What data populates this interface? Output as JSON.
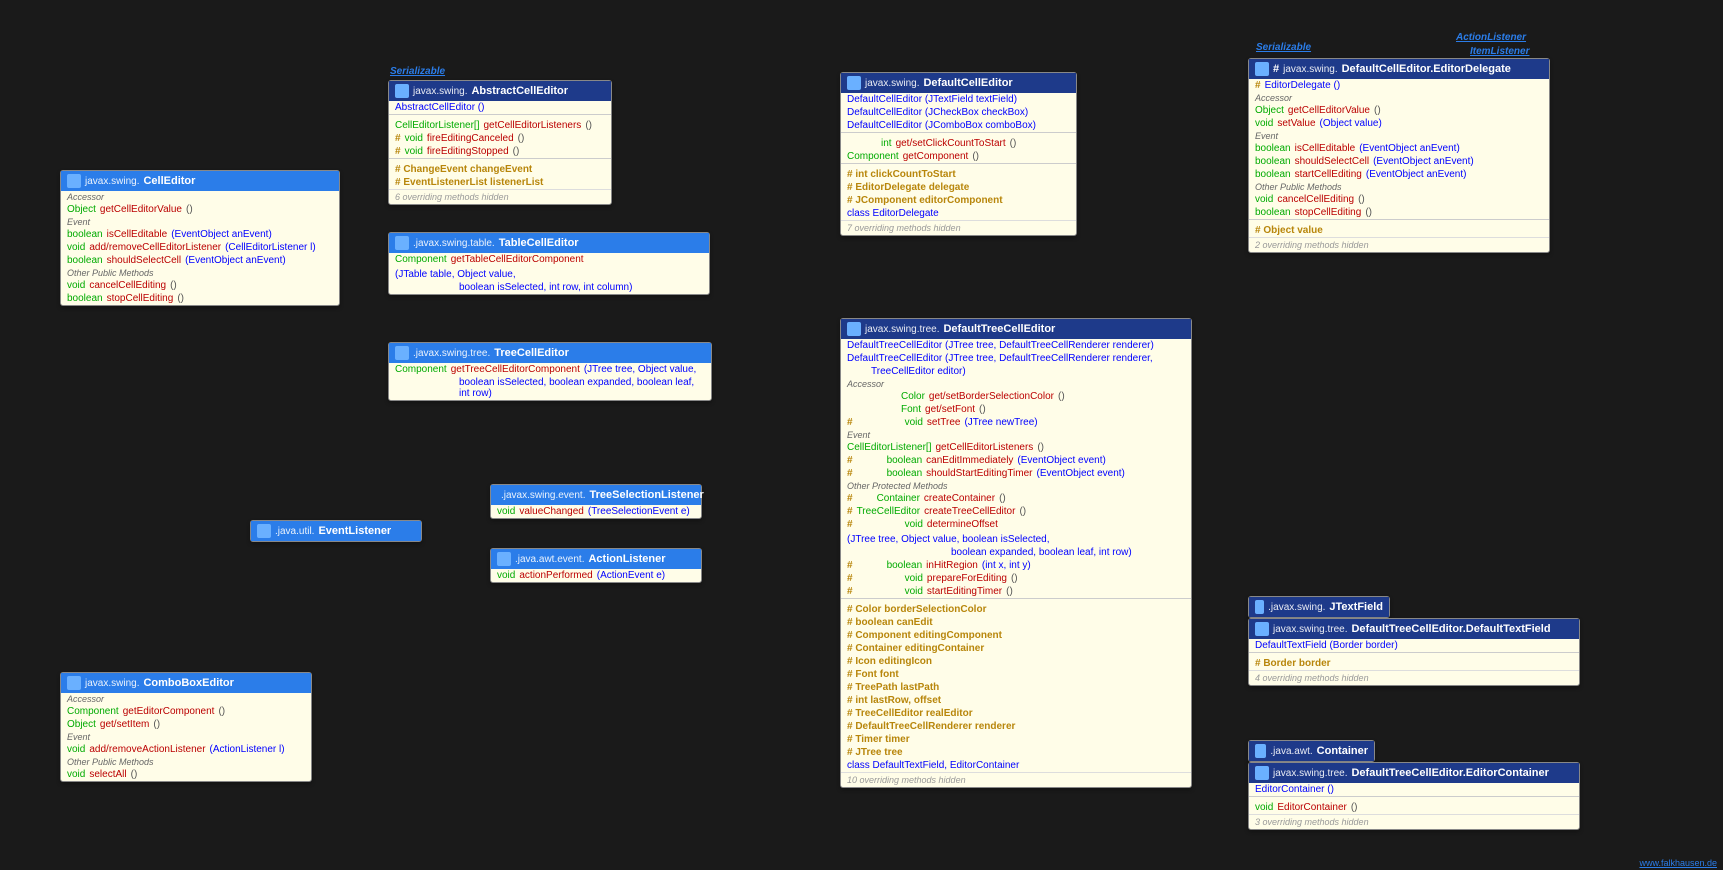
{
  "impl_serial": "Serializable",
  "impl_action": "ActionListener",
  "impl_item": "ItemListener",
  "footer": "www.falkhausen.de",
  "CellEditor": {
    "pkg": "javax.swing.",
    "title": "CellEditor",
    "lbl_accessor": "Accessor",
    "r1_t": "Object",
    "r1_n": "getCellEditorValue",
    "r1_p": "()",
    "lbl_event": "Event",
    "r2_t": "boolean",
    "r2_n": "isCellEditable",
    "r2_p": "(EventObject anEvent)",
    "r3_t": "void",
    "r3_n": "add/removeCellEditorListener",
    "r3_p": "(CellEditorListener l)",
    "r4_t": "boolean",
    "r4_n": "shouldSelectCell",
    "r4_p": "(EventObject anEvent)",
    "lbl_other": "Other Public Methods",
    "r5_t": "void",
    "r5_n": "cancelCellEditing",
    "r5_p": "()",
    "r6_t": "boolean",
    "r6_n": "stopCellEditing",
    "r6_p": "()"
  },
  "AbstractCellEditor": {
    "pkg": "javax.swing.",
    "title": "AbstractCellEditor",
    "c1": "AbstractCellEditor ()",
    "r1_t": "CellEditorListener[]",
    "r1_n": "getCellEditorListeners",
    "r1_p": "()",
    "r2_m": "#",
    "r2_t": "void",
    "r2_n": "fireEditingCanceled",
    "r2_p": "()",
    "r3_m": "#",
    "r3_t": "void",
    "r3_n": "fireEditingStopped",
    "r3_p": "()",
    "f1": "# ChangeEvent changeEvent",
    "f2": "# EventListenerList listenerList",
    "hid": "6 overriding methods hidden"
  },
  "TableCellEditor": {
    "pkg": ".javax.swing.table.",
    "title": "TableCellEditor",
    "r1_t": "Component",
    "r1_n": "getTableCellEditorComponent",
    "r1_p": "(JTable table, Object value,",
    "r1_p2": "boolean isSelected, int row, int column)"
  },
  "TreeCellEditor": {
    "pkg": ".javax.swing.tree.",
    "title": "TreeCellEditor",
    "r1_t": "Component",
    "r1_n": "getTreeCellEditorComponent",
    "r1_p": "(JTree tree, Object value,",
    "r1_p2": "boolean isSelected, boolean expanded, boolean leaf, int row)"
  },
  "EventListener": {
    "pkg": ".java.util.",
    "title": "EventListener"
  },
  "TreeSelectionListener": {
    "pkg": ".javax.swing.event.",
    "title": "TreeSelectionListener",
    "r1_t": "void",
    "r1_n": "valueChanged",
    "r1_p": "(TreeSelectionEvent e)"
  },
  "ActionListener": {
    "pkg": ".java.awt.event.",
    "title": "ActionListener",
    "r1_t": "void",
    "r1_n": "actionPerformed",
    "r1_p": "(ActionEvent e)"
  },
  "ComboBoxEditor": {
    "pkg": "javax.swing.",
    "title": "ComboBoxEditor",
    "lbl_accessor": "Accessor",
    "r1_t": "Component",
    "r1_n": "getEditorComponent",
    "r1_p": "()",
    "r2_t": "Object",
    "r2_n": "get/setItem",
    "r2_p": "()",
    "lbl_event": "Event",
    "r3_t": "void",
    "r3_n": "add/removeActionListener",
    "r3_p": "(ActionListener l)",
    "lbl_other": "Other Public Methods",
    "r4_t": "void",
    "r4_n": "selectAll",
    "r4_p": "()"
  },
  "DefaultCellEditor": {
    "pkg": "javax.swing.",
    "title": "DefaultCellEditor",
    "c1": "DefaultCellEditor (JTextField textField)",
    "c2": "DefaultCellEditor (JCheckBox checkBox)",
    "c3": "DefaultCellEditor (JComboBox comboBox)",
    "r1_t": "int",
    "r1_n": "get/setClickCountToStart",
    "r1_p": "()",
    "r2_t": "Component",
    "r2_n": "getComponent",
    "r2_p": "()",
    "f1": "# int clickCountToStart",
    "f2": "# EditorDelegate delegate",
    "f3": "# JComponent editorComponent",
    "f4": "class EditorDelegate",
    "hid": "7 overriding methods hidden"
  },
  "DefaultTreeCellEditor": {
    "pkg": "javax.swing.tree.",
    "title": "DefaultTreeCellEditor",
    "c1": "DefaultTreeCellEditor (JTree tree, DefaultTreeCellRenderer renderer)",
    "c2": "DefaultTreeCellEditor (JTree tree, DefaultTreeCellRenderer renderer,",
    "c2b": "TreeCellEditor editor)",
    "lbl_accessor": "Accessor",
    "a1_t": "Color",
    "a1_n": "get/setBorderSelectionColor",
    "a1_p": "()",
    "a2_t": "Font",
    "a2_n": "get/setFont",
    "a2_p": "()",
    "a3_m": "#",
    "a3_t": "void",
    "a3_n": "setTree",
    "a3_p": "(JTree newTree)",
    "lbl_event": "Event",
    "e1_t": "CellEditorListener[]",
    "e1_n": "getCellEditorListeners",
    "e1_p": "()",
    "e2_m": "#",
    "e2_t": "boolean",
    "e2_n": "canEditImmediately",
    "e2_p": "(EventObject event)",
    "e3_m": "#",
    "e3_t": "boolean",
    "e3_n": "shouldStartEditingTimer",
    "e3_p": "(EventObject event)",
    "lbl_other": "Other Protected Methods",
    "o1_m": "#",
    "o1_t": "Container",
    "o1_n": "createContainer",
    "o1_p": "()",
    "o2_m": "#",
    "o2_t": "TreeCellEditor",
    "o2_n": "createTreeCellEditor",
    "o2_p": "()",
    "o3_m": "#",
    "o3_t": "void",
    "o3_n": "determineOffset",
    "o3_p": "(JTree tree, Object value, boolean isSelected,",
    "o3_p2": "boolean expanded, boolean leaf, int row)",
    "o4_m": "#",
    "o4_t": "boolean",
    "o4_n": "inHitRegion",
    "o4_p": "(int x, int y)",
    "o5_m": "#",
    "o5_t": "void",
    "o5_n": "prepareForEditing",
    "o5_p": "()",
    "o6_m": "#",
    "o6_t": "void",
    "o6_n": "startEditingTimer",
    "o6_p": "()",
    "f1": "# Color borderSelectionColor",
    "f2": "# boolean canEdit",
    "f3": "# Component editingComponent",
    "f4": "# Container editingContainer",
    "f5": "# Icon editingIcon",
    "f6": "# Font font",
    "f7": "# TreePath lastPath",
    "f8": "# int lastRow, offset",
    "f9": "# TreeCellEditor realEditor",
    "f10": "# DefaultTreeCellRenderer renderer",
    "f11": "# Timer timer",
    "f12": "# JTree tree",
    "cls": "class DefaultTextField, EditorContainer",
    "hid": "10 overriding methods hidden"
  },
  "EditorDelegate": {
    "pkg": "javax.swing.",
    "title": "DefaultCellEditor.EditorDelegate",
    "c1_m": "#",
    "c1": "EditorDelegate ()",
    "lbl_accessor": "Accessor",
    "a1_t": "Object",
    "a1_n": "getCellEditorValue",
    "a1_p": "()",
    "a2_t": "void",
    "a2_n": "setValue",
    "a2_p": "(Object value)",
    "lbl_event": "Event",
    "e1_t": "boolean",
    "e1_n": "isCellEditable",
    "e1_p": "(EventObject anEvent)",
    "e2_t": "boolean",
    "e2_n": "shouldSelectCell",
    "e2_p": "(EventObject anEvent)",
    "e3_t": "boolean",
    "e3_n": "startCellEditing",
    "e3_p": "(EventObject anEvent)",
    "lbl_other": "Other Public Methods",
    "o1_t": "void",
    "o1_n": "cancelCellEditing",
    "o1_p": "()",
    "o2_t": "boolean",
    "o2_n": "stopCellEditing",
    "o2_p": "()",
    "f1": "# Object value",
    "hid": "2 overriding methods hidden"
  },
  "JTextField": {
    "pkg": ".javax.swing.",
    "title": "JTextField"
  },
  "DefaultTextField": {
    "pkg": "javax.swing.tree.",
    "title": "DefaultTreeCellEditor.DefaultTextField",
    "c1": "DefaultTextField (Border border)",
    "f1": "# Border border",
    "hid": "4 overriding methods hidden"
  },
  "Container": {
    "pkg": ".java.awt.",
    "title": "Container"
  },
  "EditorContainer": {
    "pkg": "javax.swing.tree.",
    "title": "DefaultTreeCellEditor.EditorContainer",
    "c1": "EditorContainer ()",
    "r1_t": "void",
    "r1_n": "EditorContainer",
    "r1_p": "()",
    "hid": "3 overriding methods hidden"
  }
}
